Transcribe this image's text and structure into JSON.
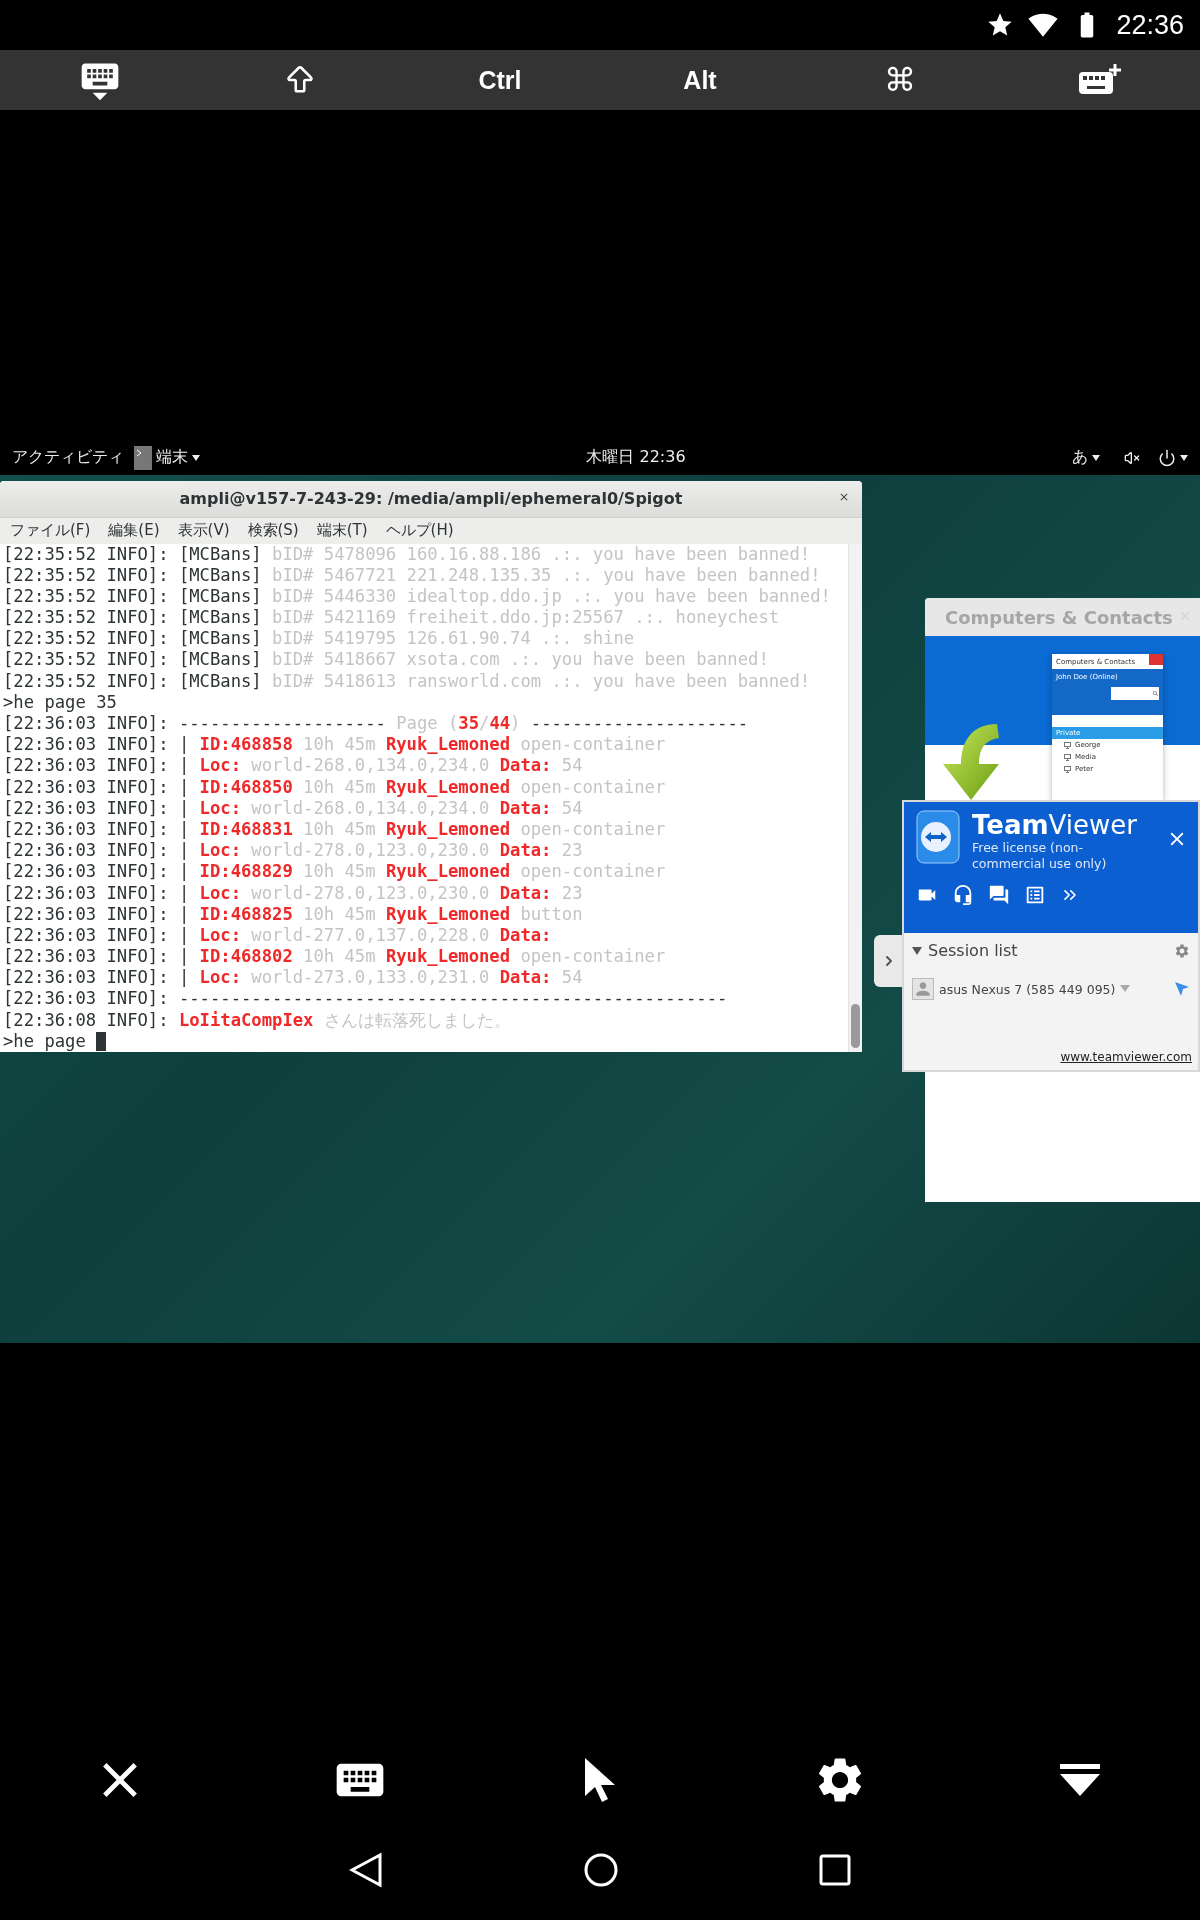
{
  "status_bar": {
    "time": "22:36"
  },
  "key_toolbar": {
    "ctrl": "Ctrl",
    "alt": "Alt",
    "command": "⌘"
  },
  "gnome_bar": {
    "activities": "アクティビティ",
    "app_menu": "端末",
    "clock": "木曜日 22:36",
    "input_method": "あ"
  },
  "terminal": {
    "title": "ampli@v157-7-243-29: /media/ampli/ephemeral0/Spigot",
    "menu": [
      "ファイル(F)",
      "編集(E)",
      "表示(V)",
      "検索(S)",
      "端末(T)",
      "ヘルプ(H)"
    ],
    "lines": [
      {
        "cursor": false,
        "segments": [
          {
            "kind": "plain",
            "text": "[22:35:52 INFO]: [MCBans] "
          },
          {
            "kind": "dim",
            "text": "bID# 5478096 160.16.88.186 .:. you have been banned!"
          }
        ]
      },
      {
        "cursor": false,
        "segments": [
          {
            "kind": "plain",
            "text": "[22:35:52 INFO]: [MCBans] "
          },
          {
            "kind": "dim",
            "text": "bID# 5467721 221.248.135.35 .:. you have been banned!"
          }
        ]
      },
      {
        "cursor": false,
        "segments": [
          {
            "kind": "plain",
            "text": "[22:35:52 INFO]: [MCBans] "
          },
          {
            "kind": "dim",
            "text": "bID# 5446330 idealtop.ddo.jp .:. you have been banned!"
          }
        ]
      },
      {
        "cursor": false,
        "segments": [
          {
            "kind": "plain",
            "text": "[22:35:52 INFO]: [MCBans] "
          },
          {
            "kind": "dim",
            "text": "bID# 5421169 freiheit.ddo.jp:25567 .:. honeychest"
          }
        ]
      },
      {
        "cursor": false,
        "segments": [
          {
            "kind": "plain",
            "text": "[22:35:52 INFO]: [MCBans] "
          },
          {
            "kind": "dim",
            "text": "bID# 5419795 126.61.90.74 .:. shine"
          }
        ]
      },
      {
        "cursor": false,
        "segments": [
          {
            "kind": "plain",
            "text": "[22:35:52 INFO]: [MCBans] "
          },
          {
            "kind": "dim",
            "text": "bID# 5418667 xsota.com .:. you have been banned!"
          }
        ]
      },
      {
        "cursor": false,
        "segments": [
          {
            "kind": "plain",
            "text": "[22:35:52 INFO]: [MCBans] "
          },
          {
            "kind": "dim",
            "text": "bID# 5418613 ransworld.com .:. you have been banned!"
          }
        ]
      },
      {
        "cursor": false,
        "segments": [
          {
            "kind": "plain",
            "text": ">he page 35"
          }
        ]
      },
      {
        "cursor": false,
        "segments": [
          {
            "kind": "plain",
            "text": "[22:36:03 INFO]: -------------------- "
          },
          {
            "kind": "dim",
            "text": "Page ("
          },
          {
            "kind": "red",
            "text": "35"
          },
          {
            "kind": "dim",
            "text": "/"
          },
          {
            "kind": "red",
            "text": "44"
          },
          {
            "kind": "dim",
            "text": ") "
          },
          {
            "kind": "plain",
            "text": "---------------------"
          }
        ]
      },
      {
        "cursor": false,
        "segments": [
          {
            "kind": "plain",
            "text": "[22:36:03 INFO]: | "
          },
          {
            "kind": "red",
            "text": "ID:468858"
          },
          {
            "kind": "dim",
            "text": " 10h 45m "
          },
          {
            "kind": "red",
            "text": "Ryuk_Lemoned"
          },
          {
            "kind": "dim",
            "text": " open-container"
          }
        ]
      },
      {
        "cursor": false,
        "segments": [
          {
            "kind": "plain",
            "text": "[22:36:03 INFO]: | "
          },
          {
            "kind": "red",
            "text": "Loc:"
          },
          {
            "kind": "dim",
            "text": " world-268.0,134.0,234.0 "
          },
          {
            "kind": "red",
            "text": "Data:"
          },
          {
            "kind": "dim",
            "text": " 54"
          }
        ]
      },
      {
        "cursor": false,
        "segments": [
          {
            "kind": "plain",
            "text": "[22:36:03 INFO]: | "
          },
          {
            "kind": "red",
            "text": "ID:468850"
          },
          {
            "kind": "dim",
            "text": " 10h 45m "
          },
          {
            "kind": "red",
            "text": "Ryuk_Lemoned"
          },
          {
            "kind": "dim",
            "text": " open-container"
          }
        ]
      },
      {
        "cursor": false,
        "segments": [
          {
            "kind": "plain",
            "text": "[22:36:03 INFO]: | "
          },
          {
            "kind": "red",
            "text": "Loc:"
          },
          {
            "kind": "dim",
            "text": " world-268.0,134.0,234.0 "
          },
          {
            "kind": "red",
            "text": "Data:"
          },
          {
            "kind": "dim",
            "text": " 54"
          }
        ]
      },
      {
        "cursor": false,
        "segments": [
          {
            "kind": "plain",
            "text": "[22:36:03 INFO]: | "
          },
          {
            "kind": "red",
            "text": "ID:468831"
          },
          {
            "kind": "dim",
            "text": " 10h 45m "
          },
          {
            "kind": "red",
            "text": "Ryuk_Lemoned"
          },
          {
            "kind": "dim",
            "text": " open-container"
          }
        ]
      },
      {
        "cursor": false,
        "segments": [
          {
            "kind": "plain",
            "text": "[22:36:03 INFO]: | "
          },
          {
            "kind": "red",
            "text": "Loc:"
          },
          {
            "kind": "dim",
            "text": " world-278.0,123.0,230.0 "
          },
          {
            "kind": "red",
            "text": "Data:"
          },
          {
            "kind": "dim",
            "text": " 23"
          }
        ]
      },
      {
        "cursor": false,
        "segments": [
          {
            "kind": "plain",
            "text": "[22:36:03 INFO]: | "
          },
          {
            "kind": "red",
            "text": "ID:468829"
          },
          {
            "kind": "dim",
            "text": " 10h 45m "
          },
          {
            "kind": "red",
            "text": "Ryuk_Lemoned"
          },
          {
            "kind": "dim",
            "text": " open-container"
          }
        ]
      },
      {
        "cursor": false,
        "segments": [
          {
            "kind": "plain",
            "text": "[22:36:03 INFO]: | "
          },
          {
            "kind": "red",
            "text": "Loc:"
          },
          {
            "kind": "dim",
            "text": " world-278.0,123.0,230.0 "
          },
          {
            "kind": "red",
            "text": "Data:"
          },
          {
            "kind": "dim",
            "text": " 23"
          }
        ]
      },
      {
        "cursor": false,
        "segments": [
          {
            "kind": "plain",
            "text": "[22:36:03 INFO]: | "
          },
          {
            "kind": "red",
            "text": "ID:468825"
          },
          {
            "kind": "dim",
            "text": " 10h 45m "
          },
          {
            "kind": "red",
            "text": "Ryuk_Lemoned"
          },
          {
            "kind": "dim",
            "text": " button"
          }
        ]
      },
      {
        "cursor": false,
        "segments": [
          {
            "kind": "plain",
            "text": "[22:36:03 INFO]: | "
          },
          {
            "kind": "red",
            "text": "Loc:"
          },
          {
            "kind": "dim",
            "text": " world-277.0,137.0,228.0 "
          },
          {
            "kind": "red",
            "text": "Data:"
          }
        ]
      },
      {
        "cursor": false,
        "segments": [
          {
            "kind": "plain",
            "text": "[22:36:03 INFO]: | "
          },
          {
            "kind": "red",
            "text": "ID:468802"
          },
          {
            "kind": "dim",
            "text": " 10h 45m "
          },
          {
            "kind": "red",
            "text": "Ryuk_Lemoned"
          },
          {
            "kind": "dim",
            "text": " open-container"
          }
        ]
      },
      {
        "cursor": false,
        "segments": [
          {
            "kind": "plain",
            "text": "[22:36:03 INFO]: | "
          },
          {
            "kind": "red",
            "text": "Loc:"
          },
          {
            "kind": "dim",
            "text": " world-273.0,133.0,231.0 "
          },
          {
            "kind": "red",
            "text": "Data:"
          },
          {
            "kind": "dim",
            "text": " 54"
          }
        ]
      },
      {
        "cursor": false,
        "segments": [
          {
            "kind": "plain",
            "text": "[22:36:03 INFO]: -----------------------------------------------------"
          }
        ]
      },
      {
        "cursor": false,
        "segments": [
          {
            "kind": "plain",
            "text": "[22:36:08 INFO]: "
          },
          {
            "kind": "red",
            "text": "LoIitaCompIex"
          },
          {
            "kind": "dim",
            "text": " さんは転落死しました。"
          }
        ]
      },
      {
        "cursor": true,
        "segments": [
          {
            "kind": "plain",
            "text": ">he page "
          }
        ]
      }
    ]
  },
  "contacts_card": {
    "title": "Computers & Contacts",
    "preview": {
      "title": "Computers & Contacts",
      "user": "John Doe (Online)",
      "group": "Private",
      "contacts": [
        "George",
        "Media",
        "Peter"
      ]
    }
  },
  "teamviewer": {
    "brand_bold": "Team",
    "brand_light": "Viewer",
    "license": "Free license (non-commercial use only)",
    "session_list": {
      "title": "Session list",
      "expanded": true,
      "sessions": [
        "asus Nexus 7 (585 449 095)"
      ]
    },
    "link": "www.teamviewer.com"
  }
}
